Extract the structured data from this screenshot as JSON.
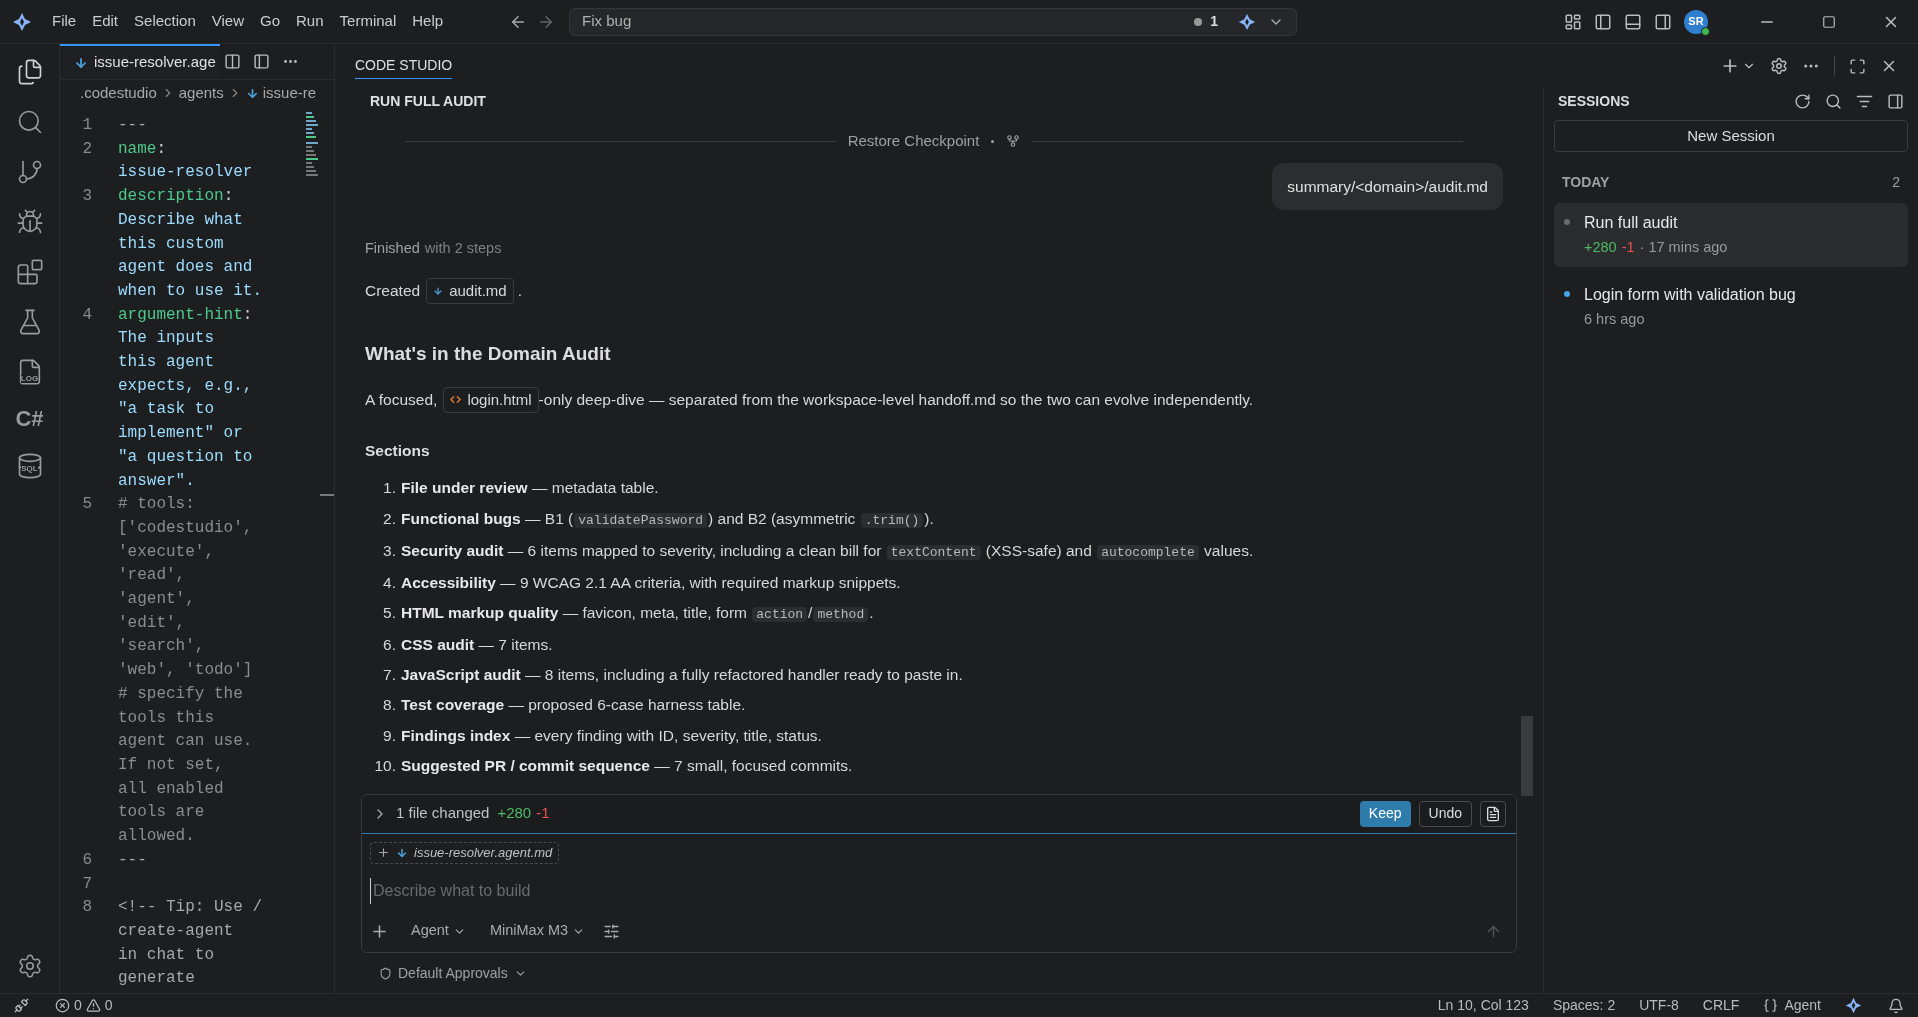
{
  "title_bar": {
    "menu": [
      "File",
      "Edit",
      "Selection",
      "View",
      "Go",
      "Run",
      "Terminal",
      "Help"
    ],
    "command_center": {
      "value": "Fix bug",
      "count": "1"
    },
    "avatar": "SR"
  },
  "activity_bar": {
    "log_label": "LOG",
    "csharp_label": "C#",
    "sql_label": "SQL"
  },
  "editor": {
    "tab": {
      "label": "issue-resolver.age",
      "selected": true
    },
    "breadcrumbs": [
      ".codestudio",
      "agents",
      "issue-re"
    ],
    "lines": [
      {
        "number": "1",
        "rows": [
          [
            {
              "kind": "plain",
              "text": "---"
            }
          ]
        ]
      },
      {
        "number": "2",
        "rows": [
          [
            {
              "kind": "key",
              "text": "name"
            },
            {
              "kind": "punct",
              "text": ":"
            }
          ],
          [
            {
              "kind": "value",
              "text": "issue-resolver"
            }
          ]
        ]
      },
      {
        "number": "3",
        "rows": [
          [
            {
              "kind": "key",
              "text": "description"
            },
            {
              "kind": "punct",
              "text": ":"
            }
          ],
          [
            {
              "kind": "value",
              "text": "Describe what"
            }
          ],
          [
            {
              "kind": "value",
              "text": "this custom"
            }
          ],
          [
            {
              "kind": "value",
              "text": "agent does and"
            }
          ],
          [
            {
              "kind": "value",
              "text": "when to use it."
            }
          ]
        ]
      },
      {
        "number": "4",
        "rows": [
          [
            {
              "kind": "key",
              "text": "argument-hint"
            },
            {
              "kind": "punct",
              "text": ":"
            }
          ],
          [
            {
              "kind": "value",
              "text": "The inputs"
            }
          ],
          [
            {
              "kind": "value",
              "text": "this agent"
            }
          ],
          [
            {
              "kind": "value",
              "text": "expects, e.g.,"
            }
          ],
          [
            {
              "kind": "value",
              "text": "\"a task to"
            }
          ],
          [
            {
              "kind": "value",
              "text": "implement\" or"
            }
          ],
          [
            {
              "kind": "value",
              "text": "\"a question to"
            }
          ],
          [
            {
              "kind": "value",
              "text": "answer\"."
            }
          ]
        ]
      },
      {
        "number": "5",
        "rows": [
          [
            {
              "kind": "comment",
              "text": "# tools:"
            }
          ],
          [
            {
              "kind": "comment",
              "text": "['codestudio',"
            }
          ],
          [
            {
              "kind": "comment",
              "text": "'execute',"
            }
          ],
          [
            {
              "kind": "comment",
              "text": "'read',"
            }
          ],
          [
            {
              "kind": "comment",
              "text": "'agent',"
            }
          ],
          [
            {
              "kind": "comment",
              "text": "'edit',"
            }
          ],
          [
            {
              "kind": "comment",
              "text": "'search',"
            }
          ],
          [
            {
              "kind": "comment",
              "text": "'web', 'todo']"
            }
          ],
          [
            {
              "kind": "comment",
              "text": "# specify the"
            }
          ],
          [
            {
              "kind": "comment",
              "text": "tools this"
            }
          ],
          [
            {
              "kind": "comment",
              "text": "agent can use."
            }
          ],
          [
            {
              "kind": "comment",
              "text": "If not set,"
            }
          ],
          [
            {
              "kind": "comment",
              "text": "all enabled"
            }
          ],
          [
            {
              "kind": "comment",
              "text": "tools are"
            }
          ],
          [
            {
              "kind": "comment",
              "text": "allowed."
            }
          ]
        ]
      },
      {
        "number": "6",
        "rows": [
          [
            {
              "kind": "plain",
              "text": "---"
            }
          ]
        ]
      },
      {
        "number": "7"
      },
      {
        "number": "8",
        "rows": [
          [
            {
              "kind": "plain",
              "text": "<!-- Tip: Use /"
            }
          ],
          [
            {
              "kind": "plain",
              "text": "create-agent"
            }
          ],
          [
            {
              "kind": "plain",
              "text": "in chat to"
            }
          ],
          [
            {
              "kind": "plain",
              "text": "generate"
            }
          ]
        ]
      }
    ]
  },
  "chat": {
    "tab": "CODE STUDIO",
    "title": "RUN FULL AUDIT",
    "checkpoint": "Restore Checkpoint",
    "user_message": "summary/<domain>/audit.md",
    "status": {
      "label": "Finished",
      "detail": "with 2 steps"
    },
    "created": {
      "before": "Created",
      "file": "audit.md",
      "after": "."
    },
    "heading": "What's in the Domain Audit",
    "intro": {
      "before": "A focused,",
      "file": "login.html",
      "after": "-only deep-dive — separated from the workspace-level handoff.md so the two can evolve independently."
    },
    "sections_title": "Sections",
    "sections": [
      {
        "number": "1.",
        "segments": [
          {
            "kind": "bold",
            "text": "File under review"
          },
          {
            "kind": "text",
            "text": " — metadata table."
          }
        ]
      },
      {
        "number": "2.",
        "segments": [
          {
            "kind": "bold",
            "text": "Functional bugs"
          },
          {
            "kind": "text",
            "text": " — B1 ("
          },
          {
            "kind": "code",
            "text": "validatePassword"
          },
          {
            "kind": "text",
            "text": ") and B2 (asymmetric "
          },
          {
            "kind": "code",
            "text": ".trim()"
          },
          {
            "kind": "text",
            "text": ")."
          }
        ]
      },
      {
        "number": "3.",
        "segments": [
          {
            "kind": "bold",
            "text": "Security audit"
          },
          {
            "kind": "text",
            "text": " — 6 items mapped to severity, including a clean bill for "
          },
          {
            "kind": "code",
            "text": "textContent"
          },
          {
            "kind": "text",
            "text": " (XSS-safe) and "
          },
          {
            "kind": "code",
            "text": "autocomplete"
          },
          {
            "kind": "text",
            "text": " values."
          }
        ]
      },
      {
        "number": "4.",
        "segments": [
          {
            "kind": "bold",
            "text": "Accessibility"
          },
          {
            "kind": "text",
            "text": " — 9 WCAG 2.1 AA criteria, with required markup snippets."
          }
        ]
      },
      {
        "number": "5.",
        "segments": [
          {
            "kind": "bold",
            "text": "HTML markup quality"
          },
          {
            "kind": "text",
            "text": " — favicon, meta, title, form "
          },
          {
            "kind": "code",
            "text": "action"
          },
          {
            "kind": "text",
            "text": "/"
          },
          {
            "kind": "code",
            "text": "method"
          },
          {
            "kind": "text",
            "text": "."
          }
        ]
      },
      {
        "number": "6.",
        "segments": [
          {
            "kind": "bold",
            "text": "CSS audit"
          },
          {
            "kind": "text",
            "text": " — 7 items."
          }
        ]
      },
      {
        "number": "7.",
        "segments": [
          {
            "kind": "bold",
            "text": "JavaScript audit"
          },
          {
            "kind": "text",
            "text": " — 8 items, including a fully refactored handler ready to paste in."
          }
        ]
      },
      {
        "number": "8.",
        "segments": [
          {
            "kind": "bold",
            "text": "Test coverage"
          },
          {
            "kind": "text",
            "text": " — proposed 6-case harness table."
          }
        ]
      },
      {
        "number": "9.",
        "segments": [
          {
            "kind": "bold",
            "text": "Findings index"
          },
          {
            "kind": "text",
            "text": " — every finding with ID, severity, title, status."
          }
        ]
      },
      {
        "number": "10.",
        "segments": [
          {
            "kind": "bold",
            "text": "Suggested PR / commit sequence"
          },
          {
            "kind": "text",
            "text": " — 7 small, focused commits."
          }
        ]
      }
    ],
    "changes": {
      "label": "1 file changed",
      "added": "+280",
      "removed": "-1",
      "keep": "Keep",
      "undo": "Undo"
    },
    "input": {
      "attachment": "issue-resolver.agent.md",
      "placeholder": "Describe what to build",
      "mode": "Agent",
      "model": "MiniMax M3"
    },
    "approvals": "Default Approvals"
  },
  "sessions": {
    "title": "SESSIONS",
    "new_button": "New Session",
    "group": "TODAY",
    "group_count": "2",
    "items": [
      {
        "title": "Run full audit",
        "selected": true,
        "color": "#6b6b6b",
        "added": "+280",
        "removed": "-1",
        "time": "· 17 mins ago"
      },
      {
        "title": "Login form with validation bug",
        "selected": false,
        "color": "#4aa3df",
        "time": "6 hrs ago"
      }
    ]
  },
  "status_bar": {
    "errors": "0",
    "warnings": "0",
    "position": "Ln 10, Col 123",
    "spaces": "Spaces: 2",
    "encoding": "UTF-8",
    "eol": "CRLF",
    "mode": "Agent"
  }
}
